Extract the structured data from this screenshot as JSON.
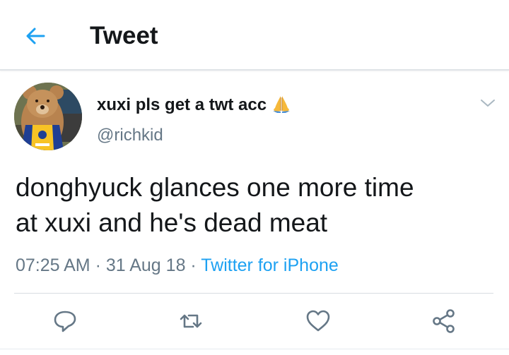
{
  "header": {
    "title": "Tweet",
    "back_icon": "arrow-left-icon",
    "accent_color": "#1da1f2"
  },
  "tweet": {
    "author": {
      "display_name": "xuxi pls get a twt acc",
      "emoji_icon": "praying-hands-icon",
      "handle": "@richkid"
    },
    "text_line1": "donghyuck glances one more time",
    "text_line2": "at xuxi and he's dead meat",
    "time": "07:25 AM",
    "sep1": " · ",
    "date": "31 Aug 18",
    "sep2": " · ",
    "source": "Twitter for iPhone"
  },
  "actions": {
    "reply_icon": "reply-icon",
    "retweet_icon": "retweet-icon",
    "like_icon": "heart-icon",
    "share_icon": "share-icon"
  }
}
